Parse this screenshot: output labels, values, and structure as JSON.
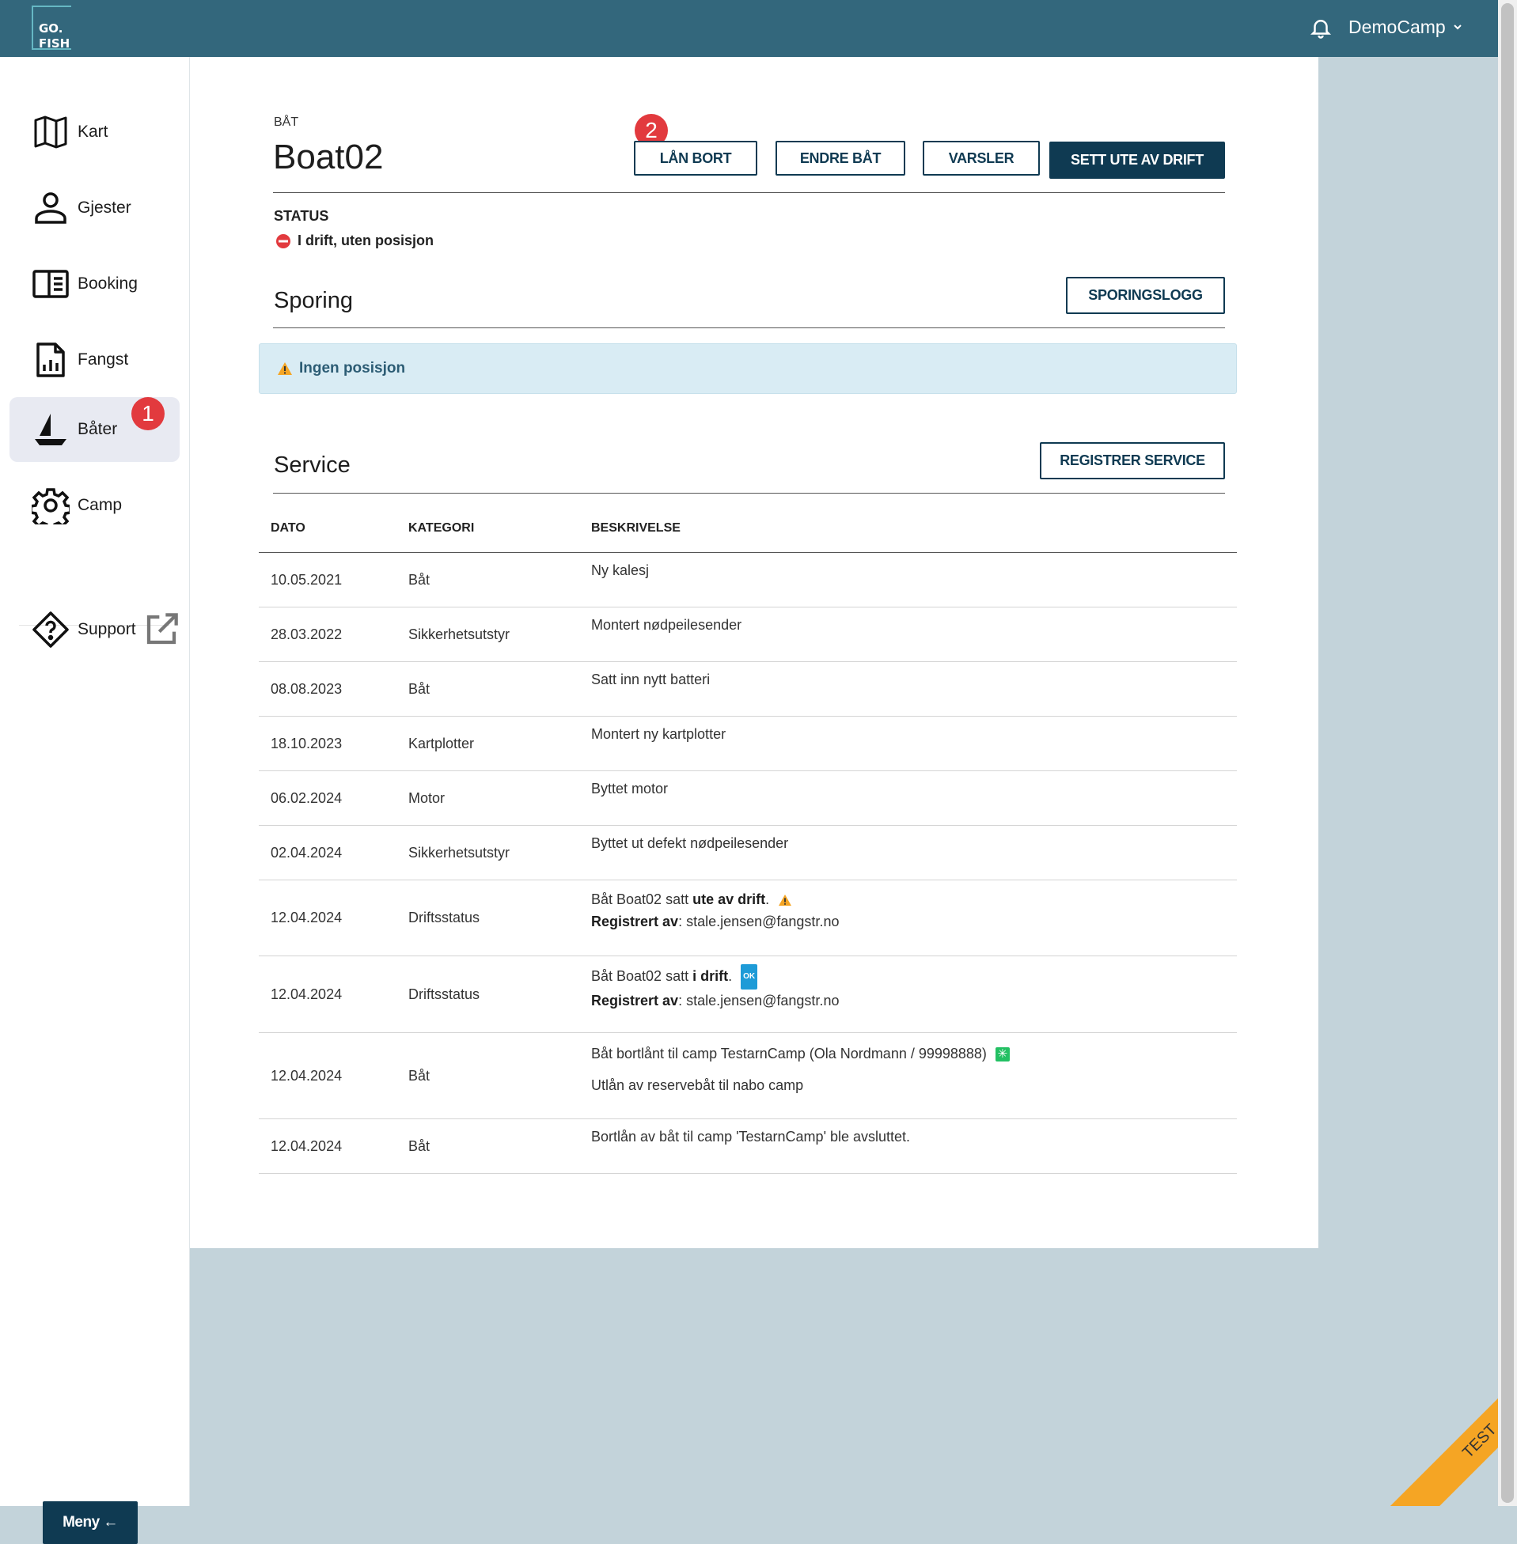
{
  "header": {
    "logo_line1": "GO.",
    "logo_line2": "FISH",
    "user_name": "DemoCamp"
  },
  "sidebar": {
    "items": [
      {
        "label": "Kart",
        "icon": "map-icon"
      },
      {
        "label": "Gjester",
        "icon": "person-icon"
      },
      {
        "label": "Booking",
        "icon": "book-icon"
      },
      {
        "label": "Fangst",
        "icon": "report-icon"
      },
      {
        "label": "Båter",
        "icon": "sailboat-icon",
        "active": true,
        "badge": "1"
      },
      {
        "label": "Camp",
        "icon": "gear-icon"
      }
    ],
    "support_label": "Support",
    "menu_button": "Meny ←"
  },
  "boat": {
    "eyebrow": "BÅT",
    "name": "Boat02",
    "badge": "2",
    "actions": {
      "lend": "LÅN BORT",
      "edit": "ENDRE BÅT",
      "alerts": "VARSLER",
      "decommission": "SETT UTE AV DRIFT"
    },
    "status_label": "STATUS",
    "status_value": "I drift, uten posisjon",
    "status_color": "#e23a3e"
  },
  "tracking": {
    "title": "Sporing",
    "log_button": "SPORINGSLOGG",
    "alert_text": "Ingen posisjon"
  },
  "service": {
    "title": "Service",
    "register_button": "REGISTRER SERVICE",
    "columns": [
      "DATO",
      "KATEGORI",
      "BESKRIVELSE"
    ],
    "rows": [
      {
        "date": "10.05.2021",
        "category": "Båt",
        "desc": "Ny kalesj"
      },
      {
        "date": "28.03.2022",
        "category": "Sikkerhetsutstyr",
        "desc": "Montert nødpeilesender"
      },
      {
        "date": "08.08.2023",
        "category": "Båt",
        "desc": "Satt inn nytt batteri"
      },
      {
        "date": "18.10.2023",
        "category": "Kartplotter",
        "desc": "Montert ny kartplotter"
      },
      {
        "date": "06.02.2024",
        "category": "Motor",
        "desc": "Byttet motor"
      },
      {
        "date": "02.04.2024",
        "category": "Sikkerhetsutstyr",
        "desc": "Byttet ut defekt nødpeilesender"
      },
      {
        "date": "12.04.2024",
        "category": "Driftsstatus",
        "desc_pre": "Båt Boat02 satt ",
        "desc_bold": "ute av drift",
        "desc_post": ".",
        "reg_label": "Registrert av",
        "reg_value": ": stale.jensen@fangstr.no"
      },
      {
        "date": "12.04.2024",
        "category": "Driftsstatus",
        "desc_pre": "Båt Boat02 satt ",
        "desc_bold": "i drift",
        "desc_post": ".",
        "ok_tag": "OK",
        "reg_label": "Registrert av",
        "reg_value": ": stale.jensen@fangstr.no"
      },
      {
        "date": "12.04.2024",
        "category": "Båt",
        "desc": "Båt bortlånt til camp TestarnCamp (Ola Nordmann / 99998888)",
        "desc2": "Utlån av reservebåt til nabo camp"
      },
      {
        "date": "12.04.2024",
        "category": "Båt",
        "desc": "Bortlån av båt til camp 'TestarnCamp' ble avsluttet."
      }
    ]
  },
  "ribbon": "TEST",
  "colors": {
    "topbar": "#33677c",
    "primary": "#0f3a52",
    "alert_bg": "#d9ecf4",
    "ribbon": "#f5a524",
    "badge": "#e23a3e"
  }
}
